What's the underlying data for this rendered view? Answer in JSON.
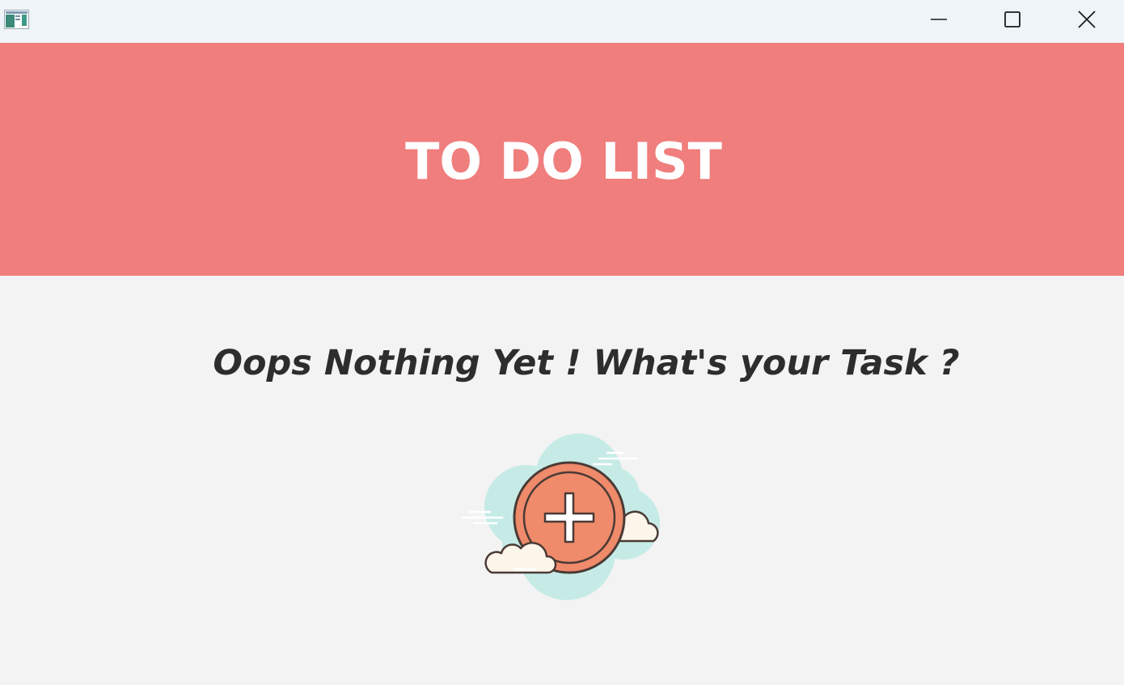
{
  "window": {
    "minimize_icon": "minimize-icon",
    "maximize_icon": "maximize-icon",
    "close_icon": "close-icon"
  },
  "header": {
    "title": "TO DO LIST",
    "background": "#ef7e7d",
    "text_color": "#ffffff"
  },
  "main": {
    "empty_message": "Oops Nothing Yet ! What's your Task ?",
    "add_icon": "add-task-cloud-icon",
    "accent": "#ef8a6b",
    "cloud_color": "#c6ebe6"
  }
}
